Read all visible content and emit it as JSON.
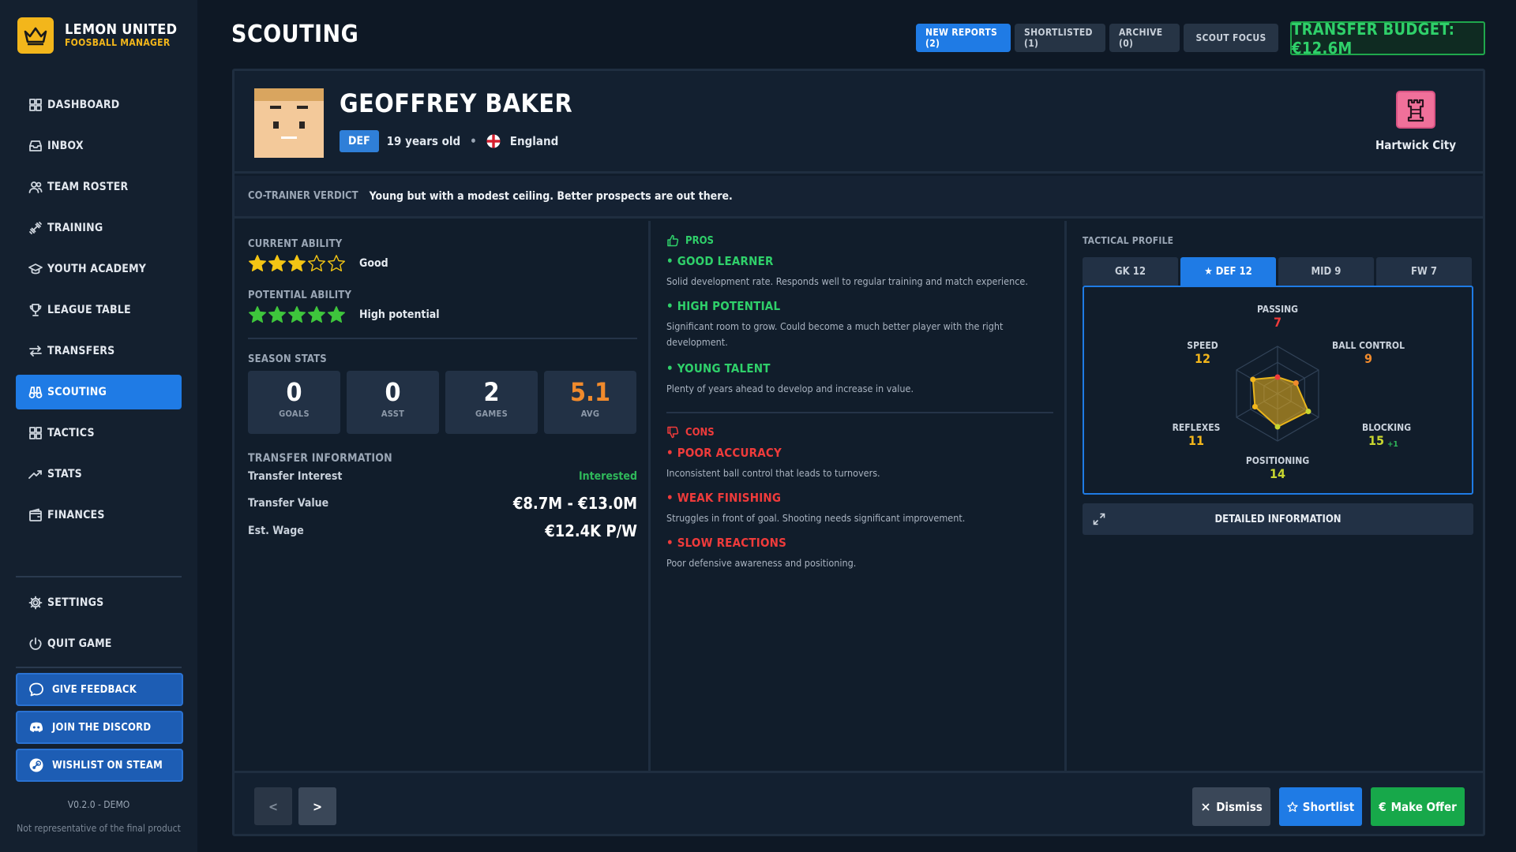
{
  "brand": {
    "name": "LEMON UNITED",
    "subtitle": "FOOSBALL MANAGER",
    "accent": "#f3b61b"
  },
  "sidebar": {
    "items": [
      {
        "label": "DASHBOARD",
        "icon": "grid-icon"
      },
      {
        "label": "INBOX",
        "icon": "inbox-icon"
      },
      {
        "label": "TEAM ROSTER",
        "icon": "users-icon"
      },
      {
        "label": "TRAINING",
        "icon": "dumbbell-icon"
      },
      {
        "label": "YOUTH ACADEMY",
        "icon": "graduation-cap-icon"
      },
      {
        "label": "LEAGUE TABLE",
        "icon": "trophy-icon"
      },
      {
        "label": "TRANSFERS",
        "icon": "transfer-arrows-icon"
      },
      {
        "label": "SCOUTING",
        "icon": "binoculars-icon",
        "active": true
      },
      {
        "label": "TACTICS",
        "icon": "tactics-grid-icon"
      },
      {
        "label": "STATS",
        "icon": "trend-up-icon"
      },
      {
        "label": "FINANCES",
        "icon": "wallet-icon"
      }
    ],
    "settings_label": "SETTINGS",
    "quit_label": "QUIT GAME",
    "feedback_label": "GIVE FEEDBACK",
    "discord_label": "JOIN THE DISCORD",
    "steam_label": "WISHLIST ON STEAM",
    "version": "V0.2.0 - DEMO",
    "disclaimer": "Not representative of the final product"
  },
  "header": {
    "title": "SCOUTING",
    "tabs": [
      {
        "label": "NEW REPORTS (2)",
        "active": true
      },
      {
        "label": "SHORTLISTED (1)"
      },
      {
        "label": "ARCHIVE (0)"
      },
      {
        "label": "SCOUT FOCUS"
      }
    ],
    "budget": "TRANSFER BUDGET: €12.6M"
  },
  "player": {
    "name": "GEOFFREY BAKER",
    "position": "DEF",
    "age": "19 years old",
    "nationality": "England",
    "club": "Hartwick City"
  },
  "verdict": {
    "label": "CO-TRAINER VERDICT",
    "text": "Young but with a modest ceiling. Better prospects are out there."
  },
  "ability": {
    "current_label": "CURRENT ABILITY",
    "current_stars": 3,
    "current_text": "Good",
    "potential_label": "POTENTIAL ABILITY",
    "potential_stars": 5,
    "potential_text": "High potential",
    "max_stars": 5
  },
  "season_stats": {
    "label": "SEASON STATS",
    "items": [
      {
        "value": "0",
        "label": "GOALS"
      },
      {
        "value": "0",
        "label": "ASST"
      },
      {
        "value": "2",
        "label": "GAMES"
      },
      {
        "value": "5.1",
        "label": "AVG"
      }
    ]
  },
  "transfer_info": {
    "label": "TRANSFER INFORMATION",
    "interest_key": "Transfer Interest",
    "interest_val": "Interested",
    "value_key": "Transfer Value",
    "value_val": "€8.7M - €13.0M",
    "wage_key": "Est. Wage",
    "wage_val": "€12.4K P/W"
  },
  "pros": {
    "label": "PROS",
    "items": [
      {
        "title": "GOOD LEARNER",
        "desc": "Solid development rate. Responds well to regular training and match experience."
      },
      {
        "title": "HIGH POTENTIAL",
        "desc": "Significant room to grow. Could become a much better player with the right development."
      },
      {
        "title": "YOUNG TALENT",
        "desc": "Plenty of years ahead to develop and increase in value."
      }
    ]
  },
  "cons": {
    "label": "CONS",
    "items": [
      {
        "title": "POOR ACCURACY",
        "desc": "Inconsistent ball control that leads to turnovers."
      },
      {
        "title": "WEAK FINISHING",
        "desc": "Struggles in front of goal. Shooting needs significant improvement."
      },
      {
        "title": "SLOW REACTIONS",
        "desc": "Poor defensive awareness and positioning."
      }
    ]
  },
  "tactical": {
    "label": "TACTICAL PROFILE",
    "tabs": [
      "GK 12",
      "★ DEF 12",
      "MID 9",
      "FW 7"
    ],
    "attributes": [
      {
        "name": "PASSING",
        "value": 7,
        "color": "#ef3b3b"
      },
      {
        "name": "BALL CONTROL",
        "value": 9,
        "color": "#f08a2c"
      },
      {
        "name": "BLOCKING",
        "value": 15,
        "color": "#c8d630",
        "delta": "+1"
      },
      {
        "name": "POSITIONING",
        "value": 14,
        "color": "#c8d630"
      },
      {
        "name": "REFLEXES",
        "value": 11,
        "color": "#f3b61b"
      },
      {
        "name": "SPEED",
        "value": 12,
        "color": "#f3b61b"
      }
    ],
    "scale_max": 20,
    "detail_label": "DETAILED INFORMATION"
  },
  "footer": {
    "prev_label": "<",
    "next_label": ">",
    "dismiss_label": "Dismiss",
    "shortlist_label": "Shortlist",
    "offer_label": "Make Offer"
  }
}
